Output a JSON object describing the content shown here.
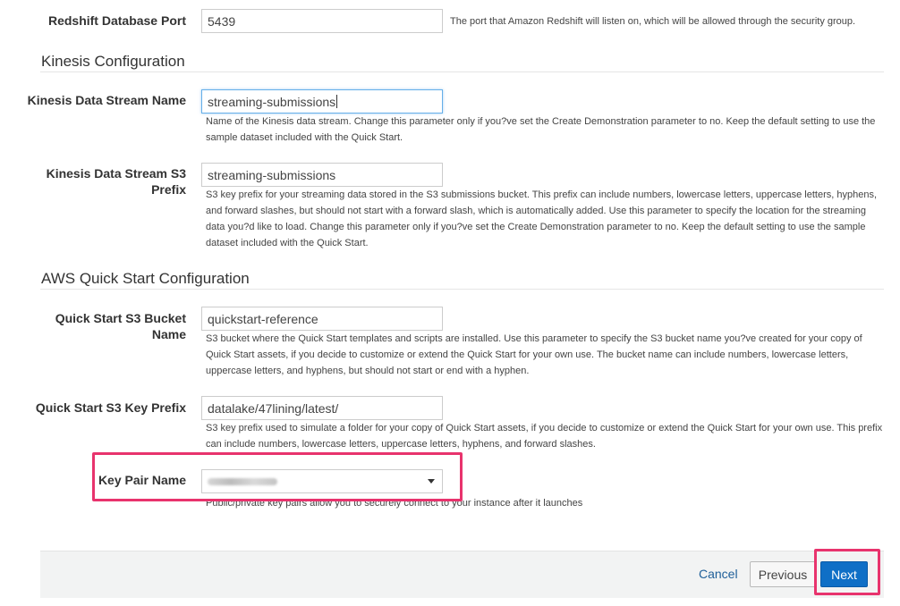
{
  "redshift": {
    "port_label": "Redshift Database Port",
    "port_value": "5439",
    "port_help": "The port that Amazon Redshift will listen on, which will be allowed through the security group."
  },
  "kinesis": {
    "section_title": "Kinesis Configuration",
    "stream_name_label": "Kinesis Data Stream Name",
    "stream_name_value": "streaming-submissions",
    "stream_name_help": "Name of the Kinesis data stream. Change this parameter only if you?ve set the Create Demonstration parameter to no. Keep the default setting to use the sample dataset included with the Quick Start.",
    "s3_prefix_label_line1": "Kinesis Data Stream S3",
    "s3_prefix_label_line2": "Prefix",
    "s3_prefix_value": "streaming-submissions",
    "s3_prefix_help": "S3 key prefix for your streaming data stored in the S3 submissions bucket. This prefix can include numbers, lowercase letters, uppercase letters, hyphens, and forward slashes, but should not start with a forward slash, which is automatically added. Use this parameter to specify the location for the streaming data you?d like to load. Change this parameter only if you?ve set the Create Demonstration parameter to no. Keep the default setting to use the sample dataset included with the Quick Start."
  },
  "quickstart": {
    "section_title": "AWS Quick Start Configuration",
    "bucket_label_line1": "Quick Start S3 Bucket",
    "bucket_label_line2": "Name",
    "bucket_value": "quickstart-reference",
    "bucket_help": "S3 bucket where the Quick Start templates and scripts are installed. Use this parameter to specify the S3 bucket name you?ve created for your copy of Quick Start assets, if you decide to customize or extend the Quick Start for your own use. The bucket name can include numbers, lowercase letters, uppercase letters, and hyphens, but should not start or end with a hyphen.",
    "key_prefix_label": "Quick Start S3 Key Prefix",
    "key_prefix_value": "datalake/47lining/latest/",
    "key_prefix_help": "S3 key prefix used to simulate a folder for your copy of Quick Start assets, if you decide to customize or extend the Quick Start for your own use. This prefix can include numbers, lowercase letters, uppercase letters, hyphens, and forward slashes.",
    "key_pair_label": "Key Pair Name",
    "key_pair_help": "Public/private key pairs allow you to securely connect to your instance after it launches"
  },
  "footer": {
    "cancel_label": "Cancel",
    "previous_label": "Previous",
    "next_label": "Next"
  },
  "colors": {
    "highlight": "#e8336d",
    "primary_button": "#0f6fc6",
    "link": "#1f5f99"
  },
  "icons": {
    "dropdown": "caret-down-icon"
  }
}
